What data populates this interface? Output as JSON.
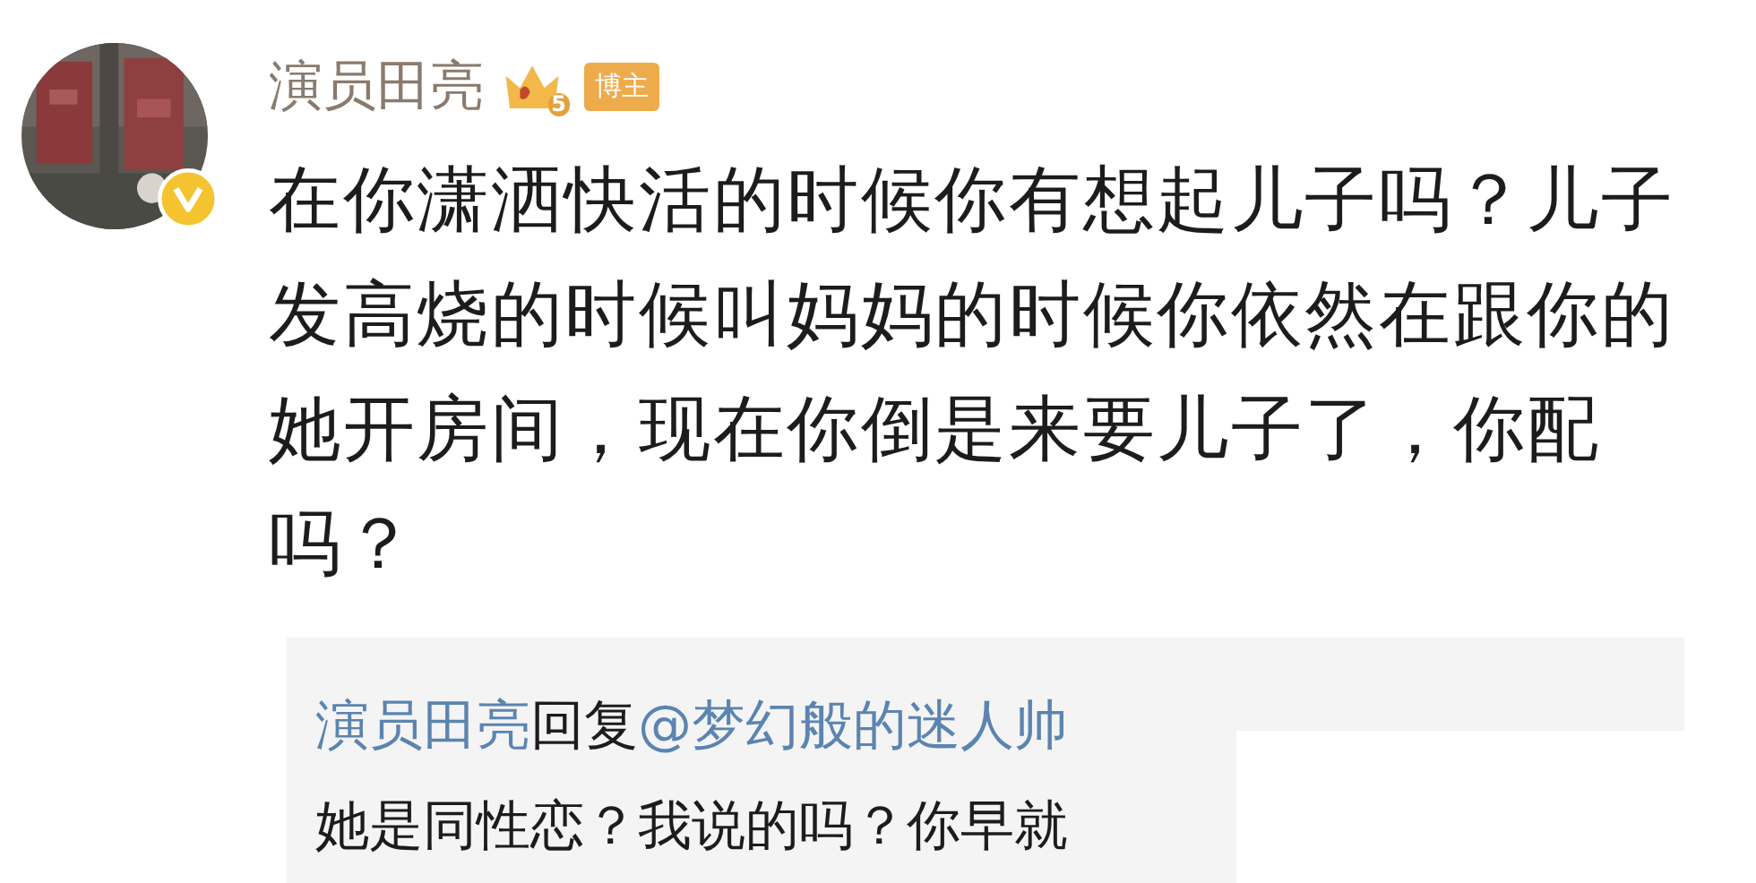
{
  "comment": {
    "avatar": {
      "kind": "picture",
      "verified": true
    },
    "author": "演员田亮",
    "rank": "5",
    "role_badge": "博主",
    "text": "在你潇洒快活的时候你有想起儿子吗？儿子发高烧的时候叫妈妈的时候你依然在跟你的她开房间，现在你倒是来要儿子了，你配吗？",
    "reply": {
      "author": "演员田亮",
      "verb": "回复",
      "mention": "@梦幻般的迷人帅",
      "text": "她是同性恋？我说的吗？你早就"
    }
  }
}
